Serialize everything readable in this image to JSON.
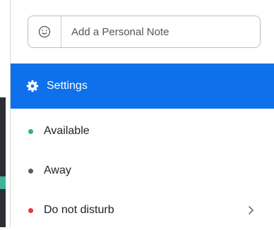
{
  "note": {
    "placeholder": "Add a Personal Note"
  },
  "settings": {
    "label": "Settings",
    "icon": "gear-icon",
    "bg": "#0e71eb"
  },
  "statuses": [
    {
      "label": "Available",
      "color": "#2fb56b"
    },
    {
      "label": "Away",
      "color": "#555b66"
    },
    {
      "label": "Do not disturb",
      "color": "#e5383b"
    }
  ]
}
